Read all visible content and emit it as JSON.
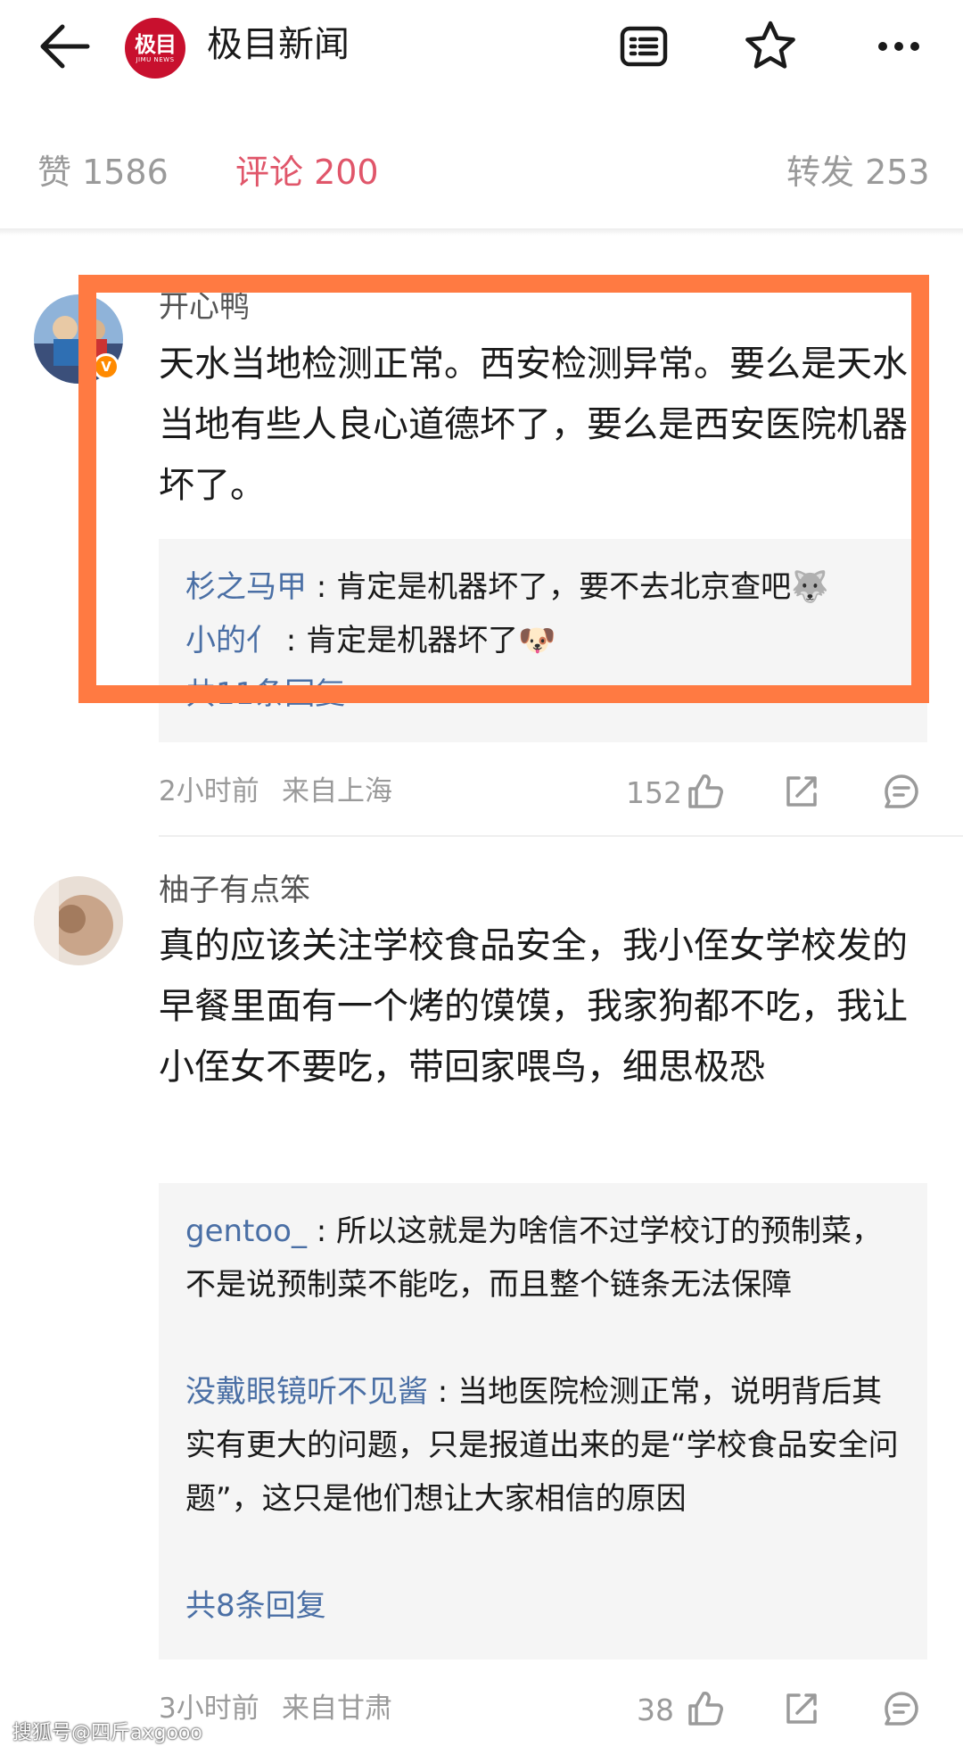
{
  "header": {
    "app_name": "极目新闻",
    "logo_text": "极目",
    "logo_subtext": "JIMU NEWS",
    "icons": [
      "back-arrow-icon",
      "article-list-icon",
      "star-icon",
      "more-icon"
    ]
  },
  "stats": {
    "likes": "赞 1586",
    "comments": "评论 200",
    "shares": "转发 253",
    "active_color": "#e0566a"
  },
  "comments": [
    {
      "user": "开心鸭",
      "verified": true,
      "badge": "V",
      "text": "天水当地检测正常。西安检测异常。要么是天水当地有些人良心道德坏了，要么是西安医院机器坏了。",
      "replies": [
        {
          "name": "杉之马甲",
          "text": "肯定是机器坏了，要不去北京查吧"
        },
        {
          "name": "小的亻",
          "text": "肯定是机器坏了"
        }
      ],
      "more_replies": "共11条回复",
      "time": "2小时前",
      "location": "来自上海",
      "likes": "152"
    },
    {
      "user": "柚子有点笨",
      "verified": false,
      "text": "真的应该关注学校食品安全，我小侄女学校发的早餐里面有一个烤的馍馍，我家狗都不吃，我让小侄女不要吃，带回家喂鸟，细思极恐",
      "replies": [
        {
          "name": "gentoo_",
          "text": "所以这就是为啥信不过学校订的预制菜，不是说预制菜不能吃，而且整个链条无法保障"
        },
        {
          "name": "没戴眼镜听不见酱",
          "text": "当地医院检测正常，说明背后其实有更大的问题，只是报道出来的是“学校食品安全问题”，这只是他们想让大家相信的原因"
        }
      ],
      "more_replies": "共8条回复",
      "time": "3小时前",
      "location": "来自甘肃",
      "likes": "38"
    }
  ],
  "highlight_color": "#ff7a42",
  "reply_name_color": "#4a6fa5",
  "watermark": "搜狐号@四斤axgooo"
}
